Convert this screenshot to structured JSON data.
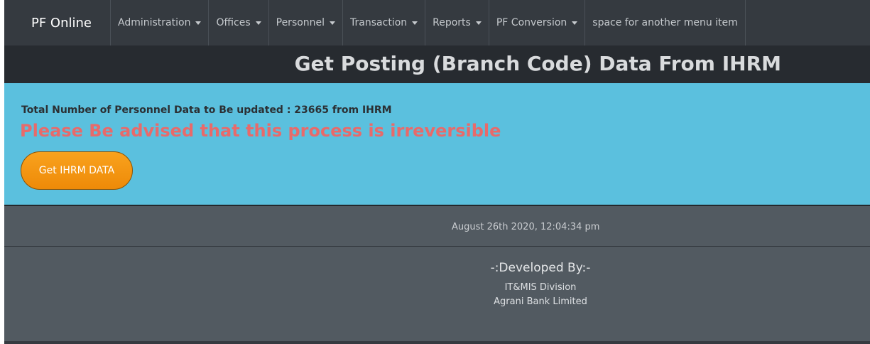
{
  "navbar": {
    "brand": "PF Online",
    "items": [
      {
        "label": "Administration",
        "has_dropdown": true
      },
      {
        "label": "Offices",
        "has_dropdown": true
      },
      {
        "label": "Personnel",
        "has_dropdown": true
      },
      {
        "label": "Transaction",
        "has_dropdown": true
      },
      {
        "label": "Reports",
        "has_dropdown": true
      },
      {
        "label": "PF Conversion",
        "has_dropdown": true
      },
      {
        "label": "space for another menu item",
        "has_dropdown": false
      }
    ]
  },
  "page": {
    "title": "Get Posting (Branch Code) Data From IHRM"
  },
  "alert": {
    "count_text": "Total Number of Personnel Data to Be updated : 23665 from IHRM",
    "warning_text": "Please Be advised that this process is irreversible",
    "button_label": "Get IHRM DATA"
  },
  "status": {
    "timestamp": "August 26th 2020, 12:04:34 pm"
  },
  "footer": {
    "heading": "-:Developed By:-",
    "division": "IT&MIS Division",
    "organization": "Agrani Bank Limited"
  },
  "colors": {
    "navbar_bg": "#353a40",
    "title_bar_bg": "#272b30",
    "alert_bg": "#5bc0de",
    "warning_text": "#e86a6a",
    "button_bg": "#f39314",
    "footer_bg": "#525a61"
  },
  "icons": {
    "dropdown": "caret-down-icon"
  }
}
